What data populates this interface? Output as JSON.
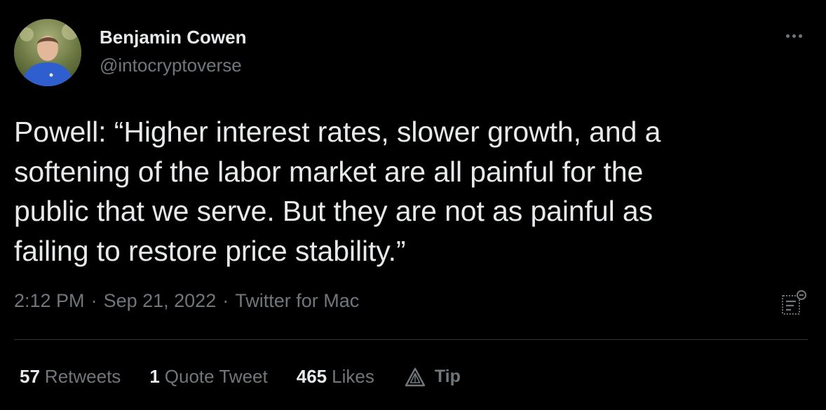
{
  "author": {
    "name": "Benjamin Cowen",
    "handle": "@intocryptoverse"
  },
  "tweet": {
    "text": "Powell: “Higher interest rates, slower growth, and a\nsoftening of the labor market are all painful for the\npublic that we serve. But they are not as painful as\nfailing to restore price stability.”",
    "time": "2:12 PM",
    "separator": "·",
    "date": "Sep 21, 2022",
    "source": "Twitter for Mac"
  },
  "stats": {
    "retweets_count": "57",
    "retweets_label": "Retweets",
    "quotes_count": "1",
    "quotes_label": "Quote Tweet",
    "likes_count": "465",
    "likes_label": "Likes",
    "tip_label": "Tip"
  },
  "icons": {
    "more": "more-options-icon",
    "analytics": "analytics-icon",
    "tip": "tip-icon"
  },
  "colors": {
    "background": "#000000",
    "primary_text": "#e7e9ea",
    "secondary_text": "#71767b",
    "divider": "#2f3336"
  }
}
